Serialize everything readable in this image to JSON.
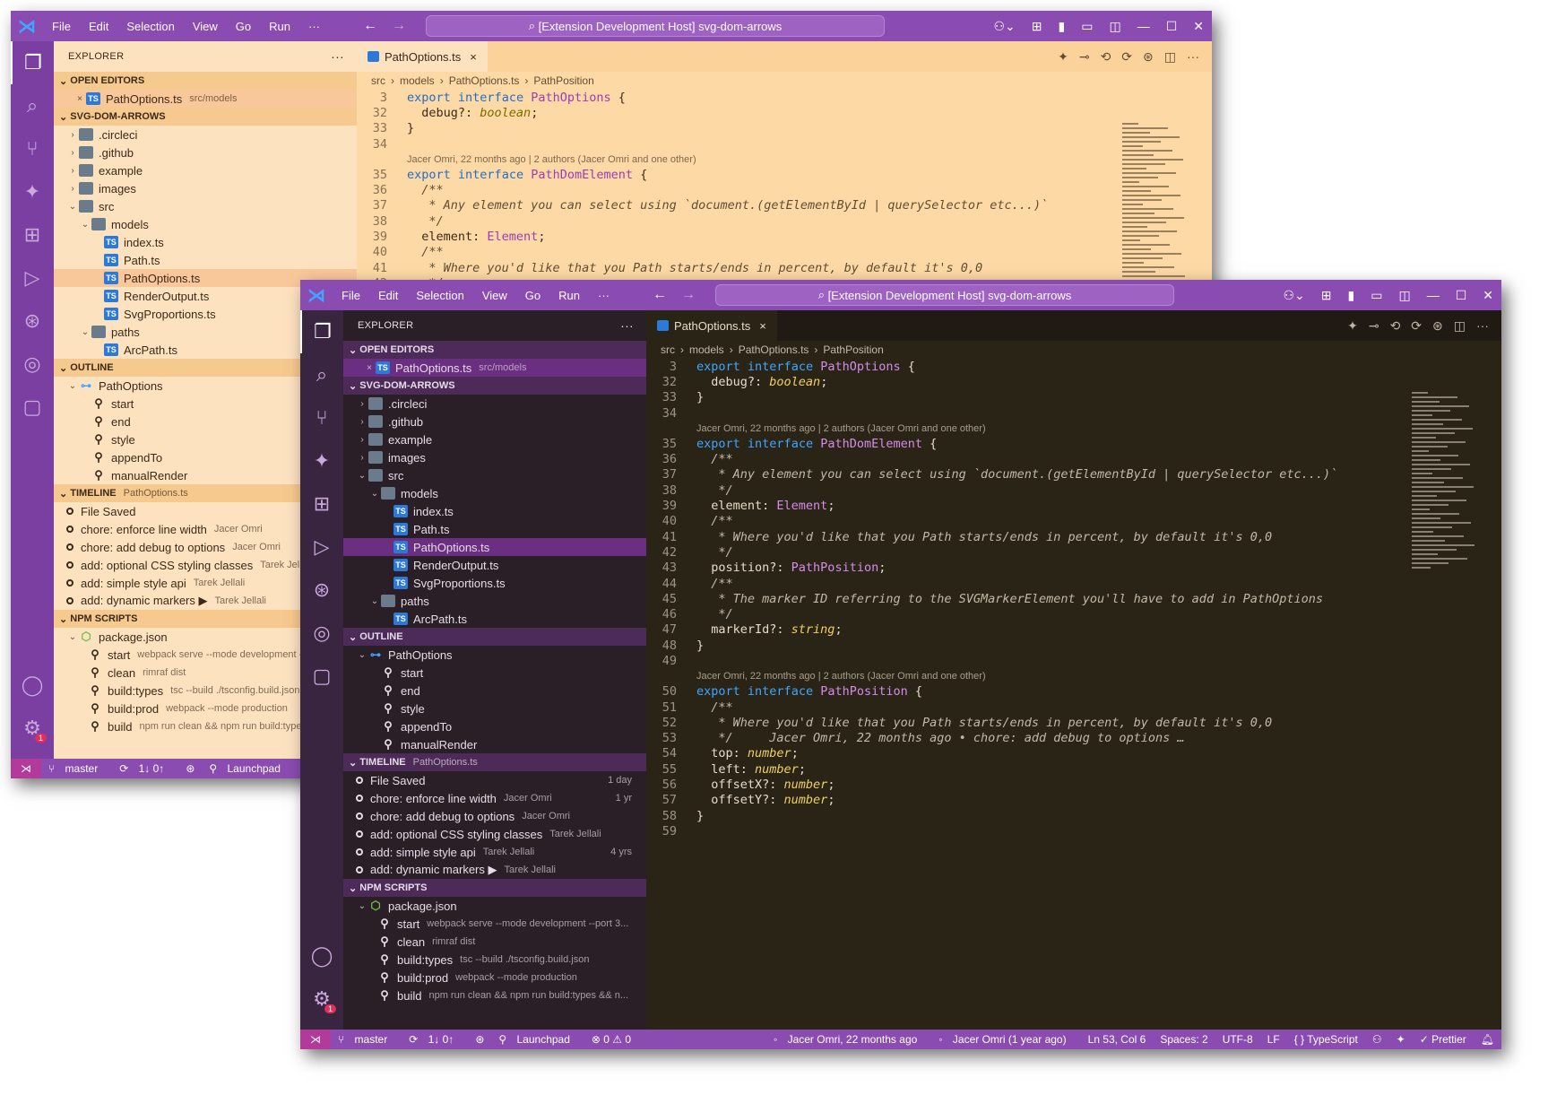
{
  "menu": [
    "File",
    "Edit",
    "Selection",
    "View",
    "Go",
    "Run",
    "···"
  ],
  "search_title": "[Extension Development Host] svg-dom-arrows",
  "explorer_title": "EXPLORER",
  "open_editors": {
    "label": "OPEN EDITORS",
    "file": "PathOptions.ts",
    "path": "src/models"
  },
  "project": {
    "label": "SVG-DOM-ARROWS",
    "items": [
      {
        "name": ".circleci",
        "depth": 1,
        "kind": "folder",
        "chev": "›"
      },
      {
        "name": ".github",
        "depth": 1,
        "kind": "folder",
        "chev": "›"
      },
      {
        "name": "example",
        "depth": 1,
        "kind": "folder",
        "chev": "›"
      },
      {
        "name": "images",
        "depth": 1,
        "kind": "folder",
        "chev": "›"
      },
      {
        "name": "src",
        "depth": 1,
        "kind": "folder",
        "chev": "⌄"
      },
      {
        "name": "models",
        "depth": 2,
        "kind": "folder",
        "chev": "⌄"
      },
      {
        "name": "index.ts",
        "depth": 3,
        "kind": "ts"
      },
      {
        "name": "Path.ts",
        "depth": 3,
        "kind": "ts"
      },
      {
        "name": "PathOptions.ts",
        "depth": 3,
        "kind": "ts",
        "selected": true
      },
      {
        "name": "RenderOutput.ts",
        "depth": 3,
        "kind": "ts"
      },
      {
        "name": "SvgProportions.ts",
        "depth": 3,
        "kind": "ts"
      },
      {
        "name": "paths",
        "depth": 2,
        "kind": "folder",
        "chev": "⌄"
      },
      {
        "name": "ArcPath.ts",
        "depth": 3,
        "kind": "ts"
      }
    ]
  },
  "outline": {
    "label": "OUTLINE",
    "root": "PathOptions",
    "items": [
      "start",
      "end",
      "style",
      "appendTo",
      "manualRender"
    ]
  },
  "timeline": {
    "label": "TIMELINE",
    "file": "PathOptions.ts",
    "items": [
      {
        "msg": "File Saved",
        "author": "",
        "time": "1 day"
      },
      {
        "msg": "chore: enforce line width",
        "author": "Jacer Omri",
        "time": "1 yr"
      },
      {
        "msg": "chore: add debug to options",
        "author": "Jacer Omri",
        "time": ""
      },
      {
        "msg": "add: optional CSS styling classes",
        "author": "Tarek Jellali",
        "time": ""
      },
      {
        "msg": "add: simple style api",
        "author": "Tarek Jellali",
        "time": "4 yrs"
      },
      {
        "msg": "add: dynamic markers ▶",
        "author": "Tarek Jellali",
        "time": ""
      }
    ]
  },
  "npm": {
    "label": "NPM SCRIPTS",
    "pkg": "package.json",
    "scripts": [
      {
        "name": "start",
        "cmd": "webpack serve --mode development --port 3..."
      },
      {
        "name": "clean",
        "cmd": "rimraf dist"
      },
      {
        "name": "build:types",
        "cmd": "tsc --build ./tsconfig.build.json"
      },
      {
        "name": "build:prod",
        "cmd": "webpack --mode production"
      },
      {
        "name": "build",
        "cmd": "npm run clean && npm run build:types && n..."
      }
    ]
  },
  "tab": {
    "label": "PathOptions.ts",
    "close": "×"
  },
  "breadcrumb": [
    "src",
    "›",
    "models",
    "›",
    "PathOptions.ts",
    "›",
    "PathPosition"
  ],
  "lens": "Jacer Omri, 22 months ago | 2 authors (Jacer Omri and one other)",
  "code_lines": [
    {
      "n": "3",
      "t": "export interface PathOptions {"
    },
    {
      "n": "32",
      "t": "  debug?: boolean;"
    },
    {
      "n": "33",
      "t": "}"
    },
    {
      "n": "34",
      "t": ""
    },
    {
      "lens": true
    },
    {
      "n": "35",
      "t": "export interface PathDomElement {"
    },
    {
      "n": "36",
      "t": "  /**"
    },
    {
      "n": "37",
      "t": "   * Any element you can select using `document.(getElementById | querySelector etc...)`"
    },
    {
      "n": "38",
      "t": "   */"
    },
    {
      "n": "39",
      "t": "  element: Element;"
    },
    {
      "n": "40",
      "t": "  /**"
    },
    {
      "n": "41",
      "t": "   * Where you'd like that you Path starts/ends in percent, by default it's 0,0"
    },
    {
      "n": "42",
      "t": "   */"
    },
    {
      "n": "43",
      "t": "  position?: PathPosition;"
    },
    {
      "n": "44",
      "t": "  /**"
    },
    {
      "n": "45",
      "t": "   * The marker ID referring to the SVGMarkerElement you'll have to add in PathOptions"
    },
    {
      "n": "46",
      "t": "   */"
    },
    {
      "n": "47",
      "t": "  markerId?: string;"
    },
    {
      "n": "48",
      "t": "}"
    },
    {
      "n": "49",
      "t": ""
    },
    {
      "lens": true
    },
    {
      "n": "50",
      "t": "export interface PathPosition {"
    },
    {
      "n": "51",
      "t": "  /**"
    },
    {
      "n": "52",
      "t": "   * Where you'd like that you Path starts/ends in percent, by default it's 0,0"
    },
    {
      "n": "53",
      "t": "   */     Jacer Omri, 22 months ago • chore: add debug to options …"
    },
    {
      "n": "54",
      "t": "  top: number;"
    },
    {
      "n": "55",
      "t": "  left: number;"
    },
    {
      "n": "56",
      "t": "  offsetX?: number;"
    },
    {
      "n": "57",
      "t": "  offsetY?: number;"
    },
    {
      "n": "58",
      "t": "}"
    },
    {
      "n": "59",
      "t": ""
    }
  ],
  "status": {
    "branch": "master",
    "sync": "1↓ 0↑",
    "launchpad": "Launchpad",
    "problems": "⊗ 0 ⚠ 0",
    "blame": "Jacer Omri, 22 months ago",
    "author": "Jacer Omri (1 year ago)",
    "position": "Ln 53, Col 6",
    "spaces": "Spaces: 2",
    "encoding": "UTF-8",
    "eol": "LF",
    "language": "{ } TypeScript",
    "formatter": "✓ Prettier"
  },
  "badge_count": "1",
  "colors": {
    "light_theme_bg": "#fde2c0",
    "dark_theme_bg": "#2a2417",
    "title_purple": "#8a4cb0"
  }
}
